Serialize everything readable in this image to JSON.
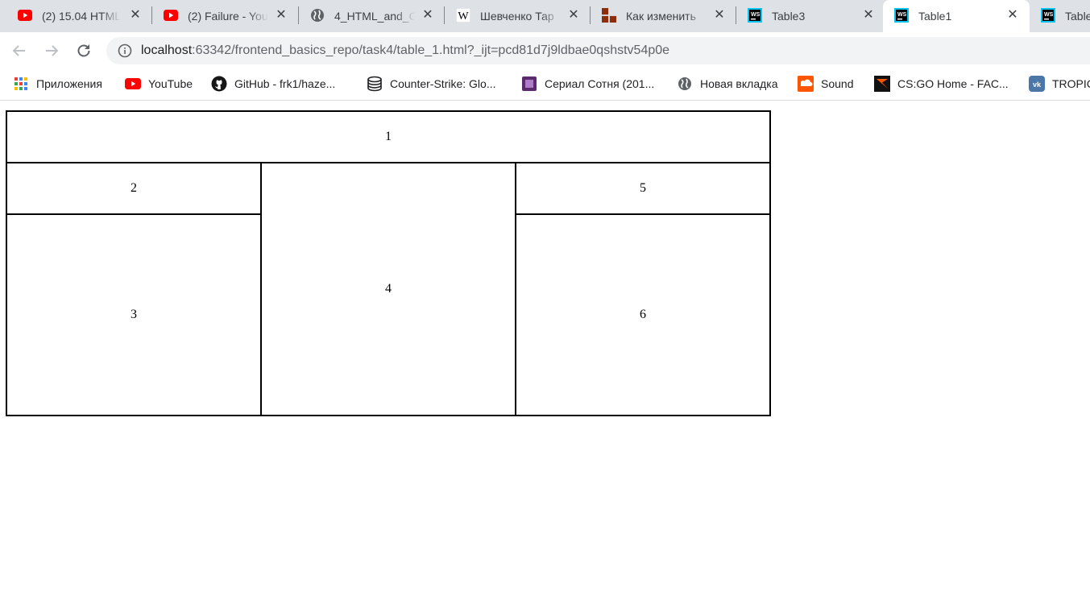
{
  "tabs": [
    {
      "title": "(2) 15.04 HTML",
      "icon": "youtube-icon",
      "active": false
    },
    {
      "title": "(2) Failure - You",
      "icon": "youtube-icon",
      "active": false
    },
    {
      "title": "4_HTML_and_C",
      "icon": "globe-icon",
      "active": false
    },
    {
      "title": "Шевченко Тар",
      "icon": "wikipedia-icon",
      "active": false
    },
    {
      "title": "Как изменить",
      "icon": "site-icon",
      "active": false
    },
    {
      "title": "Table3",
      "icon": "webstorm-icon",
      "active": false
    },
    {
      "title": "Table1",
      "icon": "webstorm-icon",
      "active": true
    },
    {
      "title": "Table",
      "icon": "webstorm-icon",
      "active": false
    }
  ],
  "address": {
    "host": "localhost",
    "rest": ":63342/frontend_basics_repo/task4/table_1.html?_ijt=pcd81d7j9ldbae0qshstv54p0e"
  },
  "bookmarks": [
    {
      "label": "Приложения",
      "icon": "apps-grid-icon"
    },
    {
      "label": "YouTube",
      "icon": "youtube-icon"
    },
    {
      "label": "GitHub - frk1/haze...",
      "icon": "github-icon"
    },
    {
      "label": "Counter-Strike: Glo...",
      "icon": "database-icon"
    },
    {
      "label": "Сериал Сотня (201...",
      "icon": "film-icon"
    },
    {
      "label": "Новая вкладка",
      "icon": "globe-icon"
    },
    {
      "label": "Sound",
      "icon": "soundcloud-icon"
    },
    {
      "label": "CS:GO Home - FAC...",
      "icon": "faceit-icon"
    },
    {
      "label": "TROPIC",
      "icon": "vk-icon"
    }
  ],
  "table": {
    "c1": "1",
    "c2": "2",
    "c3": "3",
    "c4": "4",
    "c5": "5",
    "c6": "6"
  },
  "colors": {
    "tabstrip": "#dee1e6",
    "youtube_red": "#ff0000",
    "webstorm_cyan": "#07c3f2"
  }
}
